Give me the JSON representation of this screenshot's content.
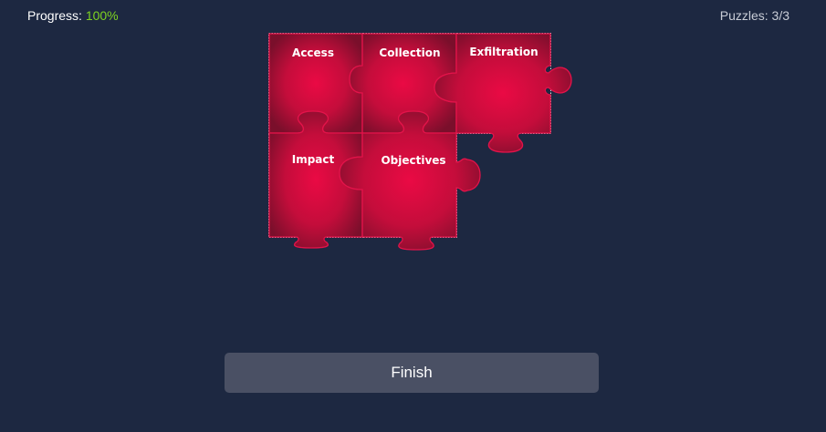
{
  "header": {
    "progress_label": "Progress:",
    "progress_value": "100%",
    "puzzles_label": "Puzzles: 3/3"
  },
  "puzzle": {
    "pieces": [
      {
        "name": "access",
        "label": "Access"
      },
      {
        "name": "collection",
        "label": "Collection"
      },
      {
        "name": "exfiltration",
        "label": "Exfiltration"
      },
      {
        "name": "impact",
        "label": "Impact"
      },
      {
        "name": "objectives",
        "label": "Objectives"
      }
    ]
  },
  "footer": {
    "finish_label": "Finish"
  },
  "colors": {
    "background": "#1d2841",
    "piece_center": "#ea0a44",
    "piece_edge": "#7a0f2b",
    "accent_green": "#7ed321"
  }
}
